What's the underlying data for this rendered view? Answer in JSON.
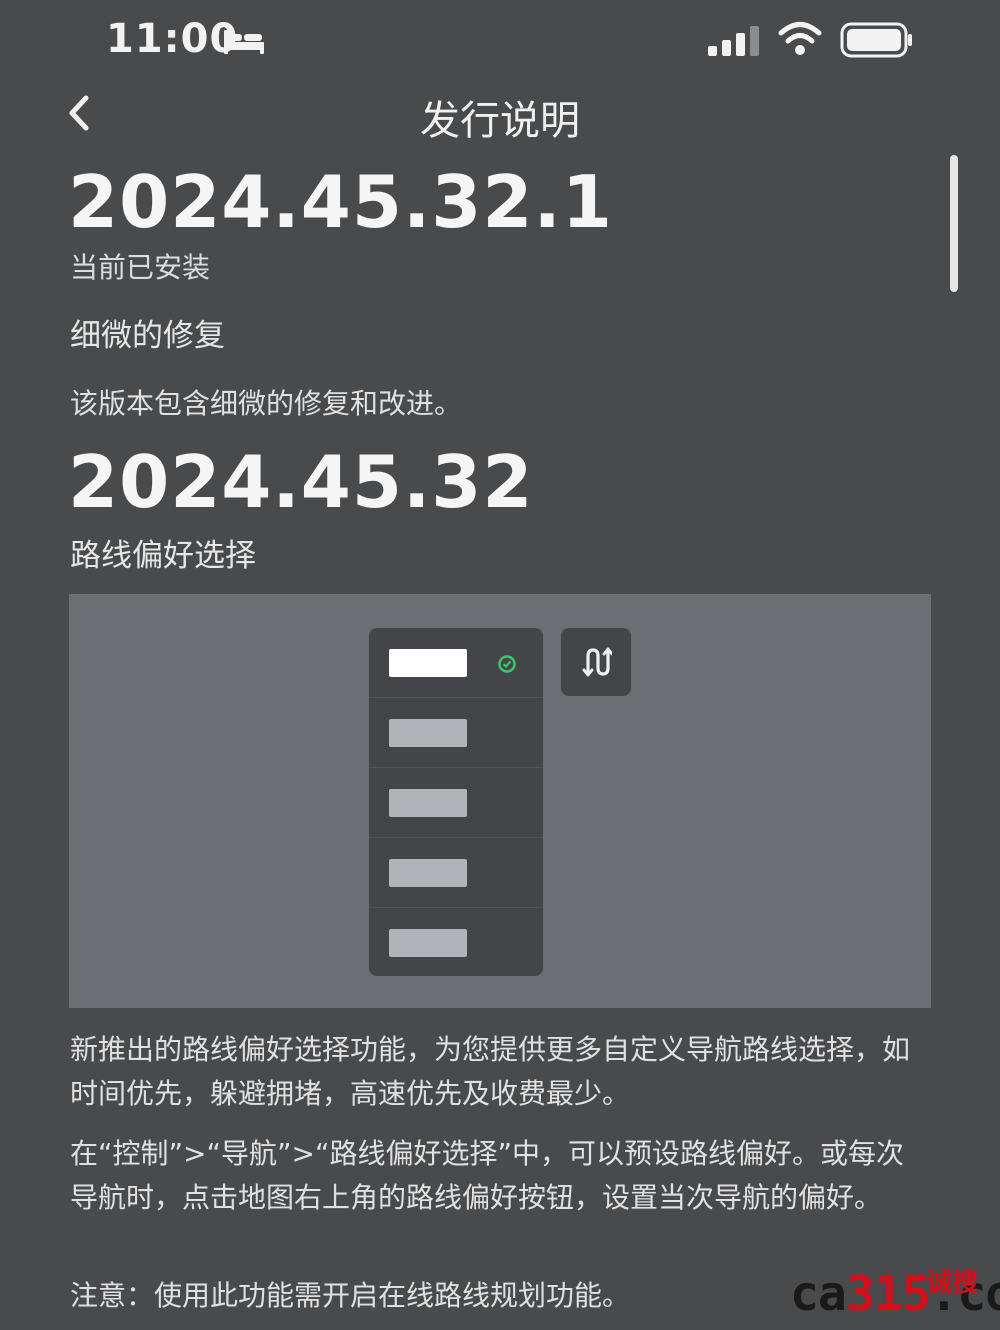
{
  "status_bar": {
    "time": "11:00",
    "icons": [
      "bed-icon",
      "signal-icon",
      "wifi-icon",
      "battery-icon"
    ]
  },
  "nav": {
    "title": "发行说明",
    "back_icon": "chevron-left-icon"
  },
  "releases": [
    {
      "version": "2024.45.32.1",
      "status": "当前已安装",
      "section_title": "细微的修复",
      "description": "该版本包含细微的修复和改进。"
    },
    {
      "version": "2024.45.32",
      "section_title": "路线偏好选择",
      "preview": {
        "menu_items": 5,
        "selected_index": 0,
        "route_button_icon": "route-icon",
        "check_icon": "check-circle-icon"
      },
      "paragraphs": [
        "新推出的路线偏好选择功能，为您提供更多自定义导航路线选择，如时间优先，躲避拥堵，高速优先及收费最少。",
        "在“控制”>“导航”>“路线偏好选择”中，可以预设路线偏好。或每次导航时，点击地图右上角的路线偏好按钮，设置当次导航的偏好。",
        "注意：使用此功能需开启在线路线规划功能。"
      ]
    }
  ],
  "watermark": {
    "text_prefix": "ca",
    "text_accent": "315",
    "text_suffix": ".com",
    "text_cn": "诚搜"
  },
  "colors": {
    "background": "#484a4c",
    "preview_bg": "#6b6e72",
    "panel_bg": "#434548",
    "check_green": "#3ec46d",
    "watermark_red": "#d0101a"
  }
}
